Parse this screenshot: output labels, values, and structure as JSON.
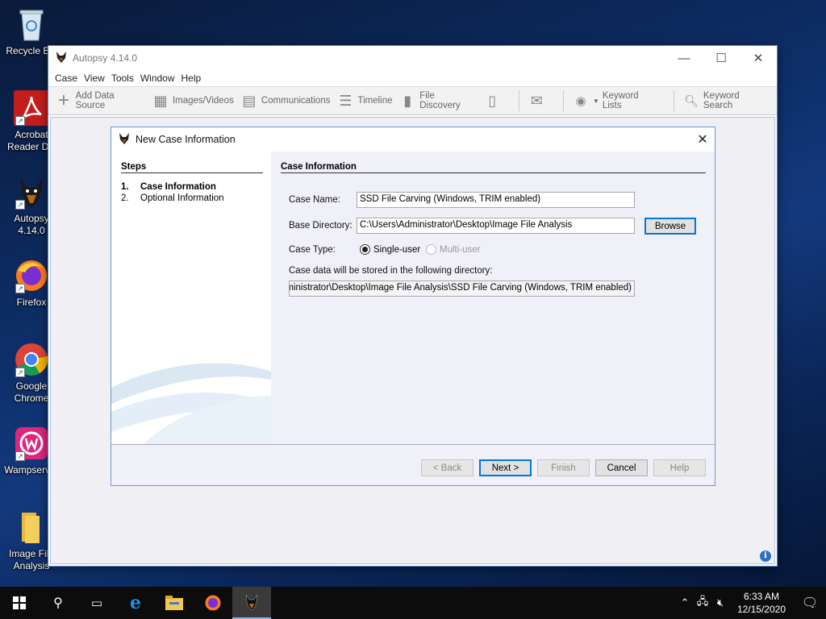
{
  "desktop": {
    "icons": [
      {
        "label": "Recycle Bin"
      },
      {
        "label": "Acrobat Reader DC"
      },
      {
        "label": "Autopsy 4.14.0"
      },
      {
        "label": "Firefox"
      },
      {
        "label": "Google Chrome"
      },
      {
        "label": "Wampserver"
      },
      {
        "label": "Image File Analysis"
      }
    ]
  },
  "app": {
    "title": "Autopsy 4.14.0",
    "menu": [
      "Case",
      "View",
      "Tools",
      "Window",
      "Help"
    ],
    "toolbar": {
      "add_data_source": "Add Data Source",
      "images_videos": "Images/Videos",
      "communications": "Communications",
      "timeline": "Timeline",
      "file_discovery": "File Discovery",
      "keyword_lists": "Keyword Lists",
      "keyword_search": "Keyword Search"
    }
  },
  "dialog": {
    "title": "New Case Information",
    "steps_heading": "Steps",
    "steps": [
      {
        "num": "1.",
        "label": "Case Information",
        "active": true
      },
      {
        "num": "2.",
        "label": "Optional Information",
        "active": false
      }
    ],
    "section_heading": "Case Information",
    "case_name_label": "Case Name:",
    "case_name_value": "SSD File Carving (Windows, TRIM enabled)",
    "base_dir_label": "Base Directory:",
    "base_dir_value": "C:\\Users\\Administrator\\Desktop\\Image File Analysis",
    "browse_label": "Browse",
    "case_type_label": "Case Type:",
    "single_user_label": "Single-user",
    "multi_user_label": "Multi-user",
    "case_type_selected": "Single-user",
    "store_label": "Case data will be stored in the following directory:",
    "store_value": "C:\\Users\\Administrator\\Desktop\\Image File Analysis\\SSD File Carving (Windows, TRIM enabled)",
    "buttons": {
      "back": "< Back",
      "next": "Next >",
      "finish": "Finish",
      "cancel": "Cancel",
      "help": "Help"
    }
  },
  "taskbar": {
    "time": "6:33 AM",
    "date": "12/15/2020"
  }
}
